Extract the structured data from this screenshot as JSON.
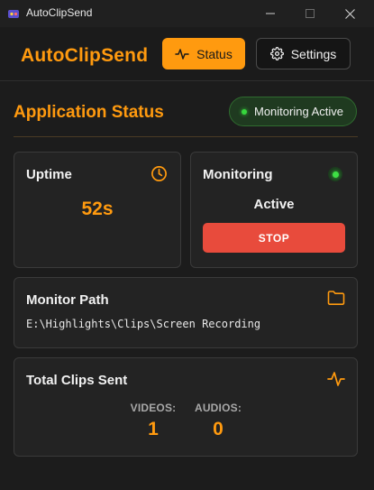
{
  "window": {
    "title": "AutoClipSend"
  },
  "header": {
    "brand": "AutoClipSend",
    "nav": {
      "status_label": "Status",
      "settings_label": "Settings"
    }
  },
  "status_section": {
    "title": "Application Status",
    "badge": "Monitoring Active"
  },
  "uptime": {
    "label": "Uptime",
    "value": "52s"
  },
  "monitoring": {
    "label": "Monitoring",
    "state": "Active",
    "stop_label": "STOP"
  },
  "monitor_path": {
    "label": "Monitor Path",
    "value": "E:\\Highlights\\Clips\\Screen Recording"
  },
  "clips": {
    "label": "Total Clips Sent",
    "videos_label": "VIDEOS:",
    "videos_value": "1",
    "audios_label": "AUDIOS:",
    "audios_value": "0"
  },
  "colors": {
    "accent": "#ff9a0f",
    "background": "#1c1c1c",
    "card": "#232323",
    "active_green": "#37d63d",
    "stop_red": "#e84b3c"
  },
  "icons": {
    "app": "app-logo-icon",
    "status": "activity-pulse-icon",
    "settings": "gear-icon",
    "uptime": "clock-icon",
    "path": "folder-icon",
    "clips": "activity-pulse-icon"
  }
}
